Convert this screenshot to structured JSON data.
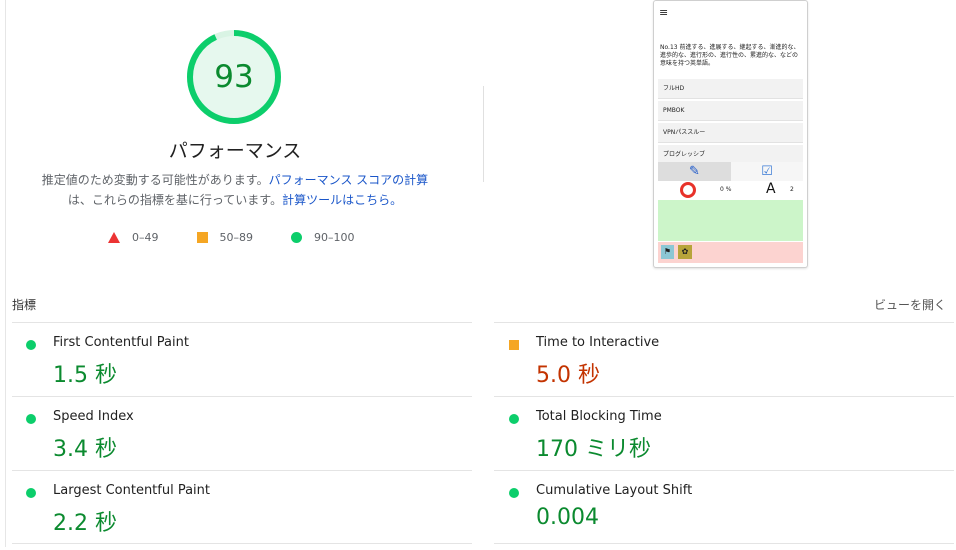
{
  "score": {
    "value": "93",
    "fraction": 0.93,
    "title": "パフォーマンス",
    "description_text": "推定値のため変動する可能性があります。",
    "description_link1": "パフォーマンス スコアの計算",
    "description_mid": "は、これらの指標を基に行っています。",
    "description_link2": "計算ツールはこちら。"
  },
  "legend": [
    {
      "label": "0–49",
      "color": "#ec3333"
    },
    {
      "label": "50–89",
      "color": "#f5a623"
    },
    {
      "label": "90–100",
      "color": "#0cce6b"
    }
  ],
  "thumbnail": {
    "menu_glyph": "≡",
    "article": "No.13 前進する、進展する、継起する、漸進的な、進歩的な、進行形の、進行性の、累進的な、などの意味を持つ英単語。",
    "links": [
      "フルHD",
      "PMBOK",
      "VPNパススルー",
      "プログレッシブ"
    ],
    "pct": "0 %",
    "letter": "A",
    "count": "2"
  },
  "metrics_section": {
    "title": "指標",
    "toggle_label": "ビューを開く"
  },
  "metrics": [
    {
      "name": "First Contentful Paint",
      "value": "1.5 秒",
      "rating": "good"
    },
    {
      "name": "Time to Interactive",
      "value": "5.0 秒",
      "rating": "average"
    },
    {
      "name": "Speed Index",
      "value": "3.4 秒",
      "rating": "good"
    },
    {
      "name": "Total Blocking Time",
      "value": "170 ミリ秒",
      "rating": "good"
    },
    {
      "name": "Largest Contentful Paint",
      "value": "2.2 秒",
      "rating": "good"
    },
    {
      "name": "Cumulative Layout Shift",
      "value": "0.004",
      "rating": "good"
    }
  ],
  "colors": {
    "good": "#0cce6b",
    "average": "#f5a623",
    "good_text": "#0b8a2f",
    "average_text": "#c33300"
  }
}
